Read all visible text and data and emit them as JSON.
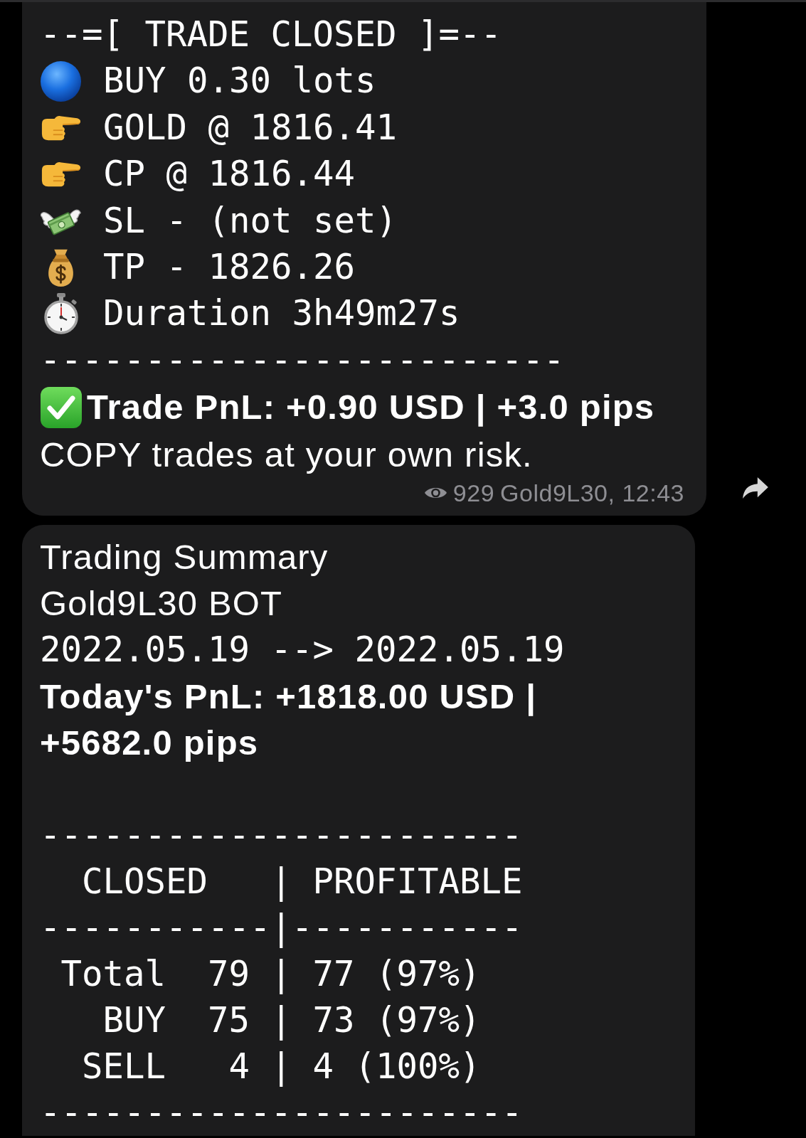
{
  "trade_closed_message": {
    "header": "--=[ TRADE CLOSED ]=--",
    "details": [
      {
        "kind": "side",
        "text": "BUY 0.30 lots"
      },
      {
        "kind": "price",
        "text": "GOLD @ 1816.41"
      },
      {
        "kind": "price",
        "text": "CP @ 1816.44"
      },
      {
        "kind": "stop-loss",
        "text": "SL - (not set)"
      },
      {
        "kind": "take-profit",
        "text": "TP - 1826.26"
      },
      {
        "kind": "duration",
        "text": "Duration 3h49m27s"
      }
    ],
    "rule": "-------------------------",
    "pnl": {
      "kind": "profit",
      "text": "Trade PnL: +0.90 USD | +3.0 pips"
    },
    "note": "COPY trades at your own risk.",
    "views": "929",
    "signature": "Gold9L30, 12:43"
  },
  "summary_message": {
    "title": "Trading Summary",
    "bot": "Gold9L30 BOT",
    "period": "2022.05.19 --> 2022.05.19",
    "pnl": "Today's PnL: +1818.00 USD | +5682.0 pips",
    "table_lines": [
      "-----------------------",
      "  CLOSED   | PROFITABLE",
      "-----------|-----------",
      " Total  79 | 77 (97%)",
      "   BUY  75 | 73 (97%)",
      "  SELL   4 | 4 (100%)",
      "-----------------------"
    ]
  }
}
